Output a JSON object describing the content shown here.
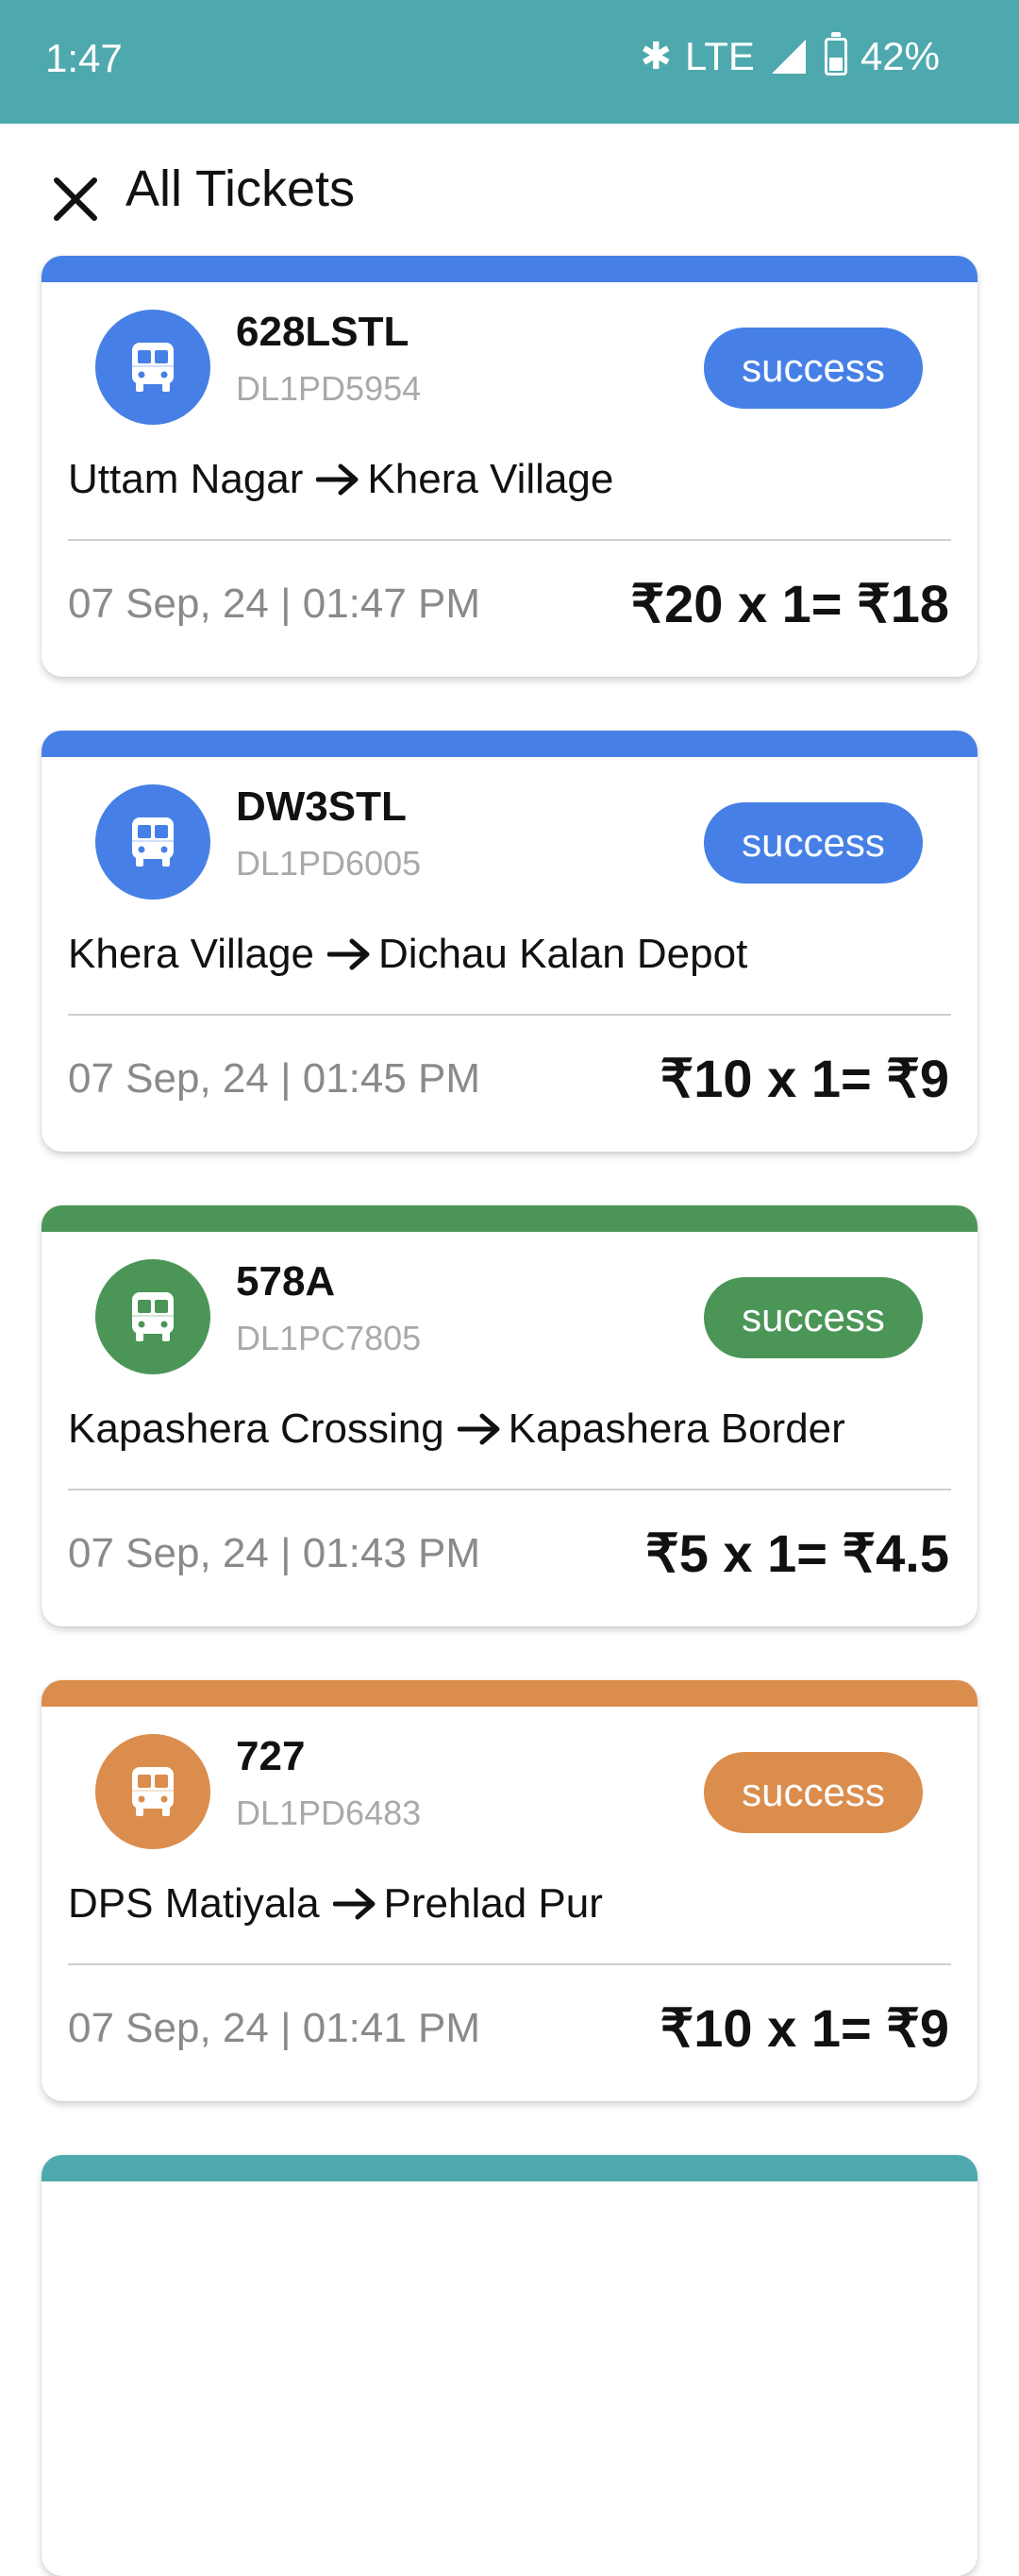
{
  "status_bar": {
    "time": "1:47",
    "network": "LTE",
    "battery": "42%"
  },
  "header": {
    "title": "All Tickets",
    "close_icon": "close-icon"
  },
  "tickets": [
    {
      "route": "628LSTL",
      "vehicle": "DL1PD5954",
      "status": "success",
      "from": "Uttam Nagar",
      "to": "Khera Village",
      "datetime": "07 Sep, 24 | 01:47 PM",
      "fare": "₹20 x 1= ₹18",
      "color": "#4680e6"
    },
    {
      "route": "DW3STL",
      "vehicle": "DL1PD6005",
      "status": "success",
      "from": "Khera Village",
      "to": "Dichau Kalan Depot",
      "datetime": "07 Sep, 24 | 01:45 PM",
      "fare": "₹10 x 1= ₹9",
      "color": "#4680e6"
    },
    {
      "route": "578A",
      "vehicle": "DL1PC7805",
      "status": "success",
      "from": "Kapashera Crossing",
      "to": "Kapashera Border",
      "datetime": "07 Sep, 24 | 01:43 PM",
      "fare": "₹5 x 1= ₹4.5",
      "color": "#4b9657"
    },
    {
      "route": "727",
      "vehicle": "DL1PD6483",
      "status": "success",
      "from": "DPS Matiyala",
      "to": "Prehlad Pur",
      "datetime": "07 Sep, 24 | 01:41 PM",
      "fare": "₹10 x 1= ₹9",
      "color": "#db8d4d"
    }
  ],
  "next_card_color": "#4ea9ae"
}
